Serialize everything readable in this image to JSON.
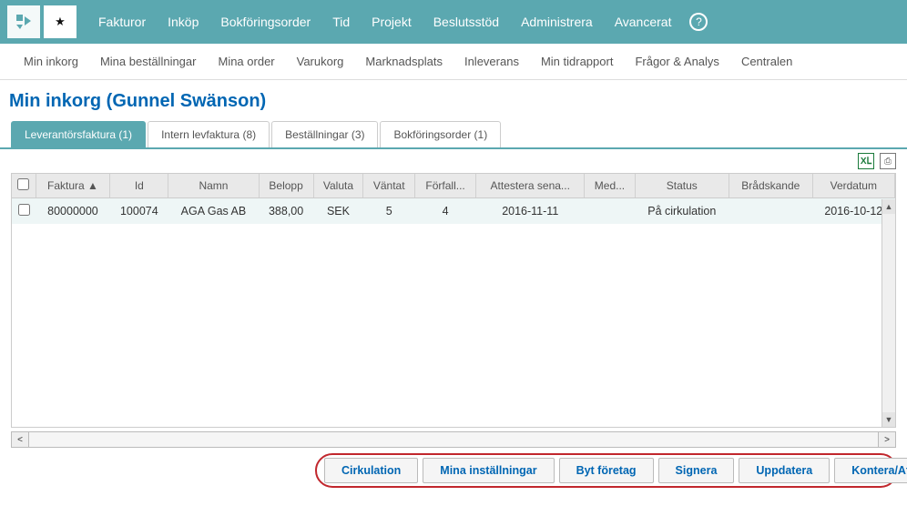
{
  "topnav": {
    "items": [
      "Fakturor",
      "Inköp",
      "Bokföringsorder",
      "Tid",
      "Projekt",
      "Beslutsstöd",
      "Administrera",
      "Avancerat"
    ]
  },
  "subnav": {
    "items": [
      "Min inkorg",
      "Mina beställningar",
      "Mina order",
      "Varukorg",
      "Marknadsplats",
      "Inleverans",
      "Min tidrapport",
      "Frågor & Analys",
      "Centralen"
    ]
  },
  "page_title": "Min inkorg (Gunnel Swänson)",
  "tabs": [
    {
      "label": "Leverantörsfaktura (1)",
      "active": true
    },
    {
      "label": "Intern levfaktura (8)",
      "active": false
    },
    {
      "label": "Beställningar (3)",
      "active": false
    },
    {
      "label": "Bokföringsorder (1)",
      "active": false
    }
  ],
  "table": {
    "headers": [
      "Faktura ▲",
      "Id",
      "Namn",
      "Belopp",
      "Valuta",
      "Väntat",
      "Förfall...",
      "Attestera sena...",
      "Med...",
      "Status",
      "Brådskande",
      "Verdatum"
    ],
    "rows": [
      {
        "faktura": "80000000",
        "id": "100074",
        "namn": "AGA Gas AB",
        "belopp": "388,00",
        "valuta": "SEK",
        "vantat": "5",
        "forfall": "4",
        "attestera": "2016-11-11",
        "med": "",
        "status": "På cirkulation",
        "bradskande": "",
        "verdatum": "2016-10-12"
      }
    ]
  },
  "actions": [
    "Cirkulation",
    "Mina inställningar",
    "Byt företag",
    "Signera",
    "Uppdatera",
    "Kontera/Attestera"
  ],
  "icons": {
    "excel": "XⅬ",
    "print": "⎙",
    "help": "?",
    "star": "★"
  }
}
